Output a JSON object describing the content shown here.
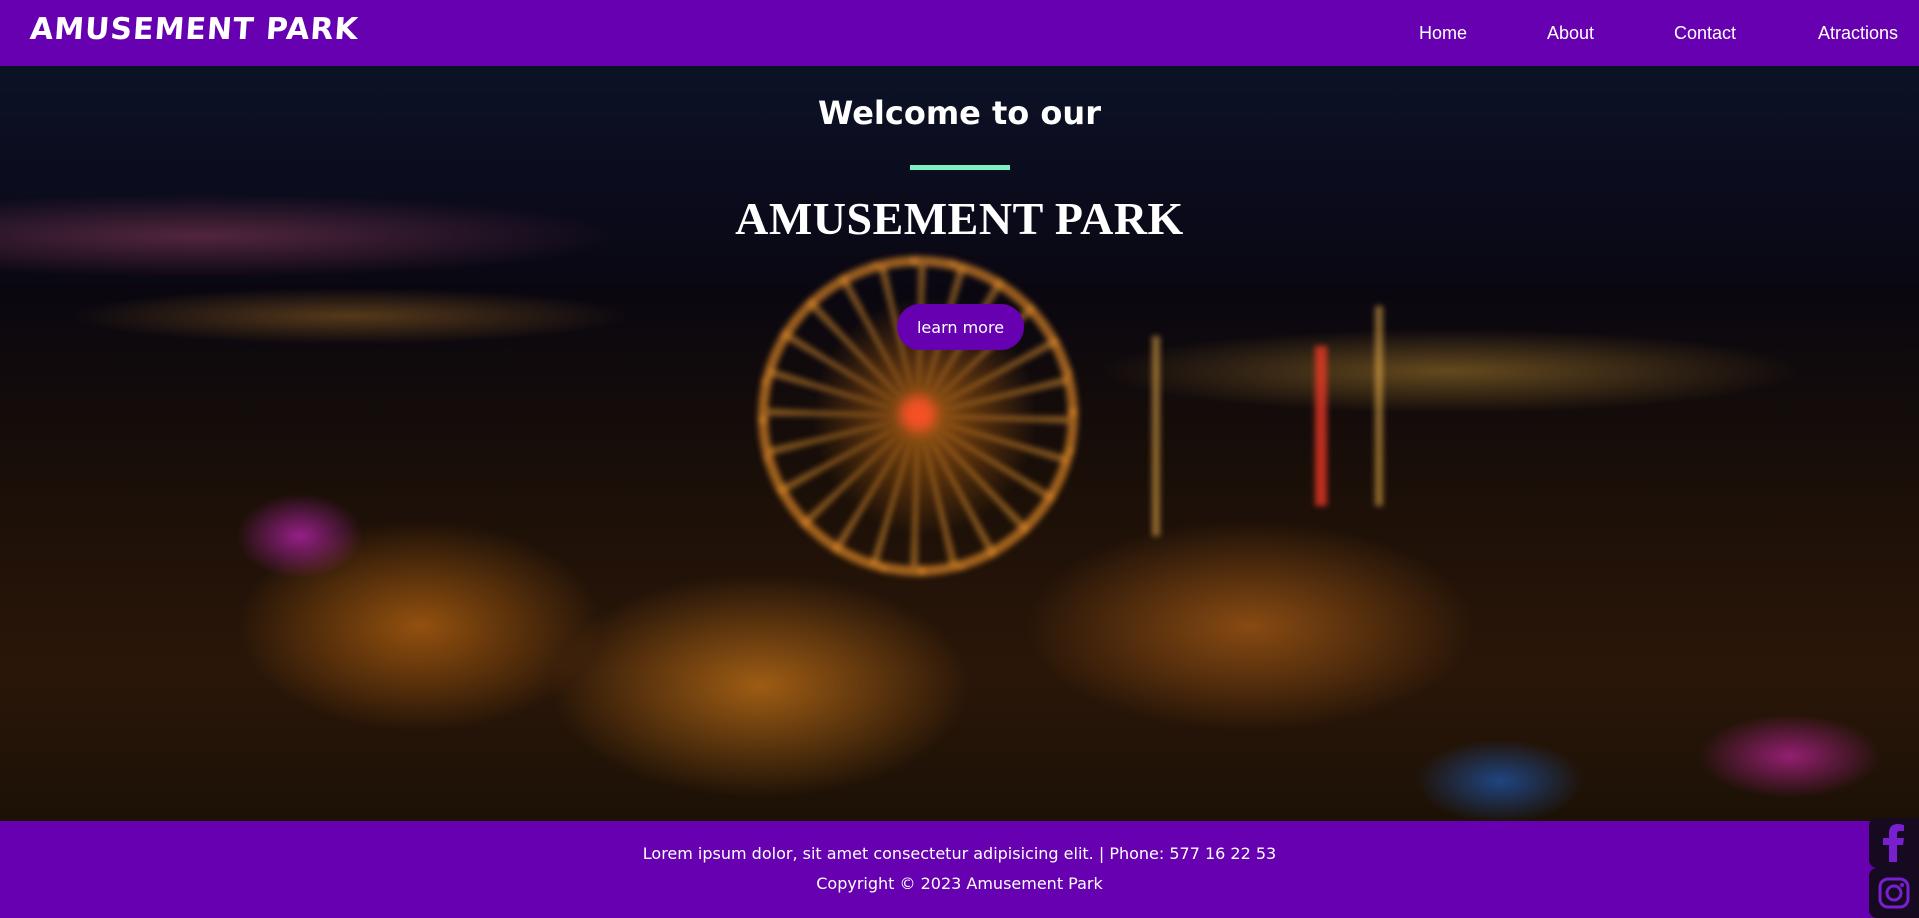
{
  "header": {
    "logo": "AMUSEMENT PARK",
    "nav": [
      {
        "label": "Home"
      },
      {
        "label": "About"
      },
      {
        "label": "Contact"
      },
      {
        "label": "Atractions"
      }
    ]
  },
  "hero": {
    "welcome": "Welcome to our",
    "title": "AMUSEMENT PARK",
    "button_label": "learn more"
  },
  "footer": {
    "line1": "Lorem ipsum dolor, sit amet consectetur adipisicing elit. | Phone: 577 16 22 53",
    "line2": "Copyright © 2023 Amusement Park"
  },
  "social": {
    "icons": [
      "facebook-icon",
      "instagram-icon"
    ]
  },
  "colors": {
    "brand_purple": "#6700b0",
    "accent_mint": "#7ff0c4"
  }
}
